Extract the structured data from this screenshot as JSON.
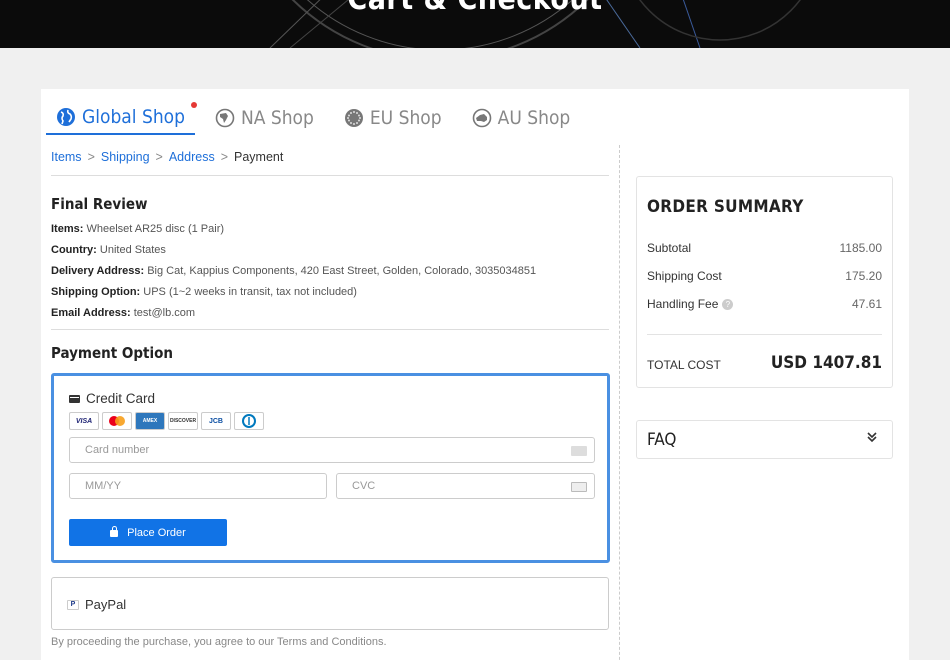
{
  "hero": {
    "title": "Cart & Checkout"
  },
  "tabs": [
    {
      "label": "Global Shop",
      "icon": "globe-icon"
    },
    {
      "label": "NA Shop",
      "icon": "north-america-icon"
    },
    {
      "label": "EU Shop",
      "icon": "eu-icon"
    },
    {
      "label": "AU Shop",
      "icon": "australia-icon"
    }
  ],
  "breadcrumb": {
    "items": "Items",
    "shipping": "Shipping",
    "address": "Address",
    "current": "Payment",
    "sep": ">"
  },
  "review": {
    "title": "Final Review",
    "items_label": "Items:",
    "items_value": "Wheelset AR25 disc (1 Pair)",
    "country_label": "Country:",
    "country_value": "United States",
    "delivery_label": "Delivery Address:",
    "delivery_value": "Big Cat, Kappius Components, 420 East Street, Golden, Colorado, 3035034851",
    "shipping_label": "Shipping Option:",
    "shipping_value": "UPS (1~2 weeks in transit, tax not included)",
    "email_label": "Email Address:",
    "email_value": "test@lb.com"
  },
  "payment": {
    "title": "Payment Option",
    "credit_card_label": "Credit Card",
    "card_logos": [
      "VISA",
      "MC",
      "AMEX",
      "DISCOVER",
      "JCB",
      "DINERS"
    ],
    "card_number_placeholder": "Card number",
    "expiry_placeholder": "MM/YY",
    "cvc_placeholder": "CVC",
    "place_order_label": "Place Order",
    "paypal_label": "PayPal",
    "terms": "By proceeding the purchase, you agree to our Terms and Conditions."
  },
  "summary": {
    "title": "ORDER SUMMARY",
    "subtotal_label": "Subtotal",
    "subtotal_value": "1185.00",
    "shipping_label": "Shipping Cost",
    "shipping_value": "175.20",
    "handling_label": "Handling Fee",
    "handling_value": "47.61",
    "total_label": "TOTAL COST",
    "total_value": "USD 1407.81"
  },
  "faq": {
    "title": "FAQ"
  },
  "colors": {
    "accent": "#1e6fd9",
    "button": "#1173e6",
    "highlight_border": "#4a90e2"
  }
}
